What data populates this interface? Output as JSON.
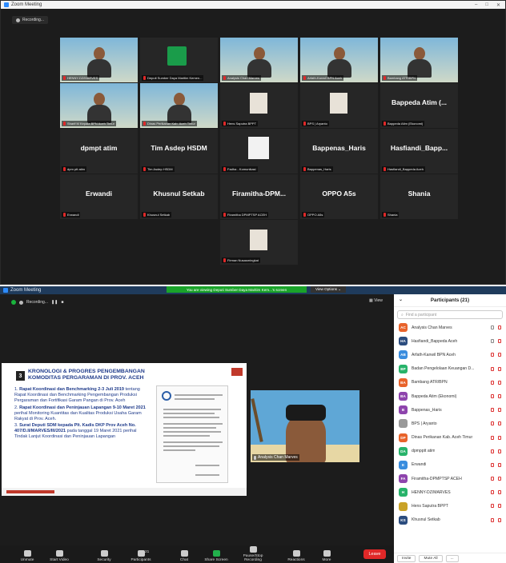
{
  "win1": {
    "title": "Zoom Meeting",
    "controls": [
      "–",
      "□",
      "✕"
    ],
    "recording": "Recording...",
    "tiles": [
      {
        "name": "",
        "label": "HENNY-DZ/MARVES",
        "kind": "video"
      },
      {
        "name": "",
        "label": "Deputi Sumber Daya Maritim Kemen...",
        "kind": "logo"
      },
      {
        "name": "",
        "label": "Analysis Chan Marves",
        "kind": "video",
        "selected": true
      },
      {
        "name": "",
        "label": "Arfath-Kanwil BPN Aceh",
        "kind": "video"
      },
      {
        "name": "",
        "label": "Bambang ATR/BPN",
        "kind": "video"
      },
      {
        "name": "",
        "label": "Sharif M Kepala BPN Aceh Timur",
        "kind": "video"
      },
      {
        "name": "",
        "label": "Dinas Perikanan Kab. Aceh Timur",
        "kind": "video"
      },
      {
        "name": "",
        "label": "Hens Saputra BPPT",
        "kind": "photo"
      },
      {
        "name": "",
        "label": "BPS | Aryanto",
        "kind": "photo"
      },
      {
        "name": "Bappeda Atim (...",
        "label": "Bappeda Atim (Ekonomi)",
        "kind": "name"
      },
      {
        "name": "dpmpt atim",
        "label": "dpm ptt atim",
        "kind": "name"
      },
      {
        "name": "Tim Asdep HSDM",
        "label": "Tim Asdep HSDM",
        "kind": "name"
      },
      {
        "name": "",
        "label": "Fadha - Komunikasi",
        "kind": "blank"
      },
      {
        "name": "Bappenas_Haris",
        "label": "Bappenas_Haris",
        "kind": "name"
      },
      {
        "name": "Hasfiandi_Bapp...",
        "label": "Hasfiandi_Bappeda Aceh",
        "kind": "name"
      },
      {
        "name": "Erwandi",
        "label": "Erwandi",
        "kind": "name"
      },
      {
        "name": "Khusnul Setkab",
        "label": "Khusnul Setkab",
        "kind": "name"
      },
      {
        "name": "Firamitha-DPM...",
        "label": "Firamitha DPMPTSP ACEH",
        "kind": "name"
      },
      {
        "name": "OPPO A5s",
        "label": "OPPO A5s",
        "kind": "name"
      },
      {
        "name": "Shania",
        "label": "Shania",
        "kind": "name"
      },
      {
        "name": "",
        "label": "Firman Nusasmingkat",
        "kind": "photo"
      }
    ]
  },
  "win2": {
    "title": "Zoom Meeting",
    "viewing": "You are viewing Deputi Sumber Daya Maritim Kem...'s screen",
    "view_options": "View Options ⌄",
    "recording": "Recording...",
    "view_label": "View",
    "slide": {
      "number": "3",
      "title_line1": "KRONOLOGI & PROGRES PENGEMBANGAN",
      "title_line2": "KOMODITAS PERGARAMAN DI PROV. ACEH",
      "items": [
        {
          "num": "1.",
          "bold": "Rapat Koordinasi dan Benchmarking 2-3 Juli 2019",
          "text": " tentang Rapat Koordinasi dan Benchmarking Pengembangan Produksi Pergaraman dan Fortifikasi Garam Pangan di Prov. Aceh"
        },
        {
          "num": "2.",
          "bold": "Rapat Koordinasi dan Peninjauan Lapangan 9-10 Maret 2021",
          "text": " perihal Monitoring Kuantitas dan Kualitas Produksi Usaha Garam Rakyat di Prov. Aceh."
        },
        {
          "num": "3.",
          "bold": "Surat Deputi SDM kepada Plt. Kadis DKP Prov Aceh No. 407/D.II/MARVES/III/2021",
          "text": " pada tanggal 19 Maret 2021 perihal Tindak Lanjut Koordinasi dan Peninjauan Lapangan"
        }
      ]
    },
    "speaker_label": "Analysis Chan Marves",
    "toolbar": [
      {
        "label": "Unmute",
        "icon": "microphone-icon"
      },
      {
        "label": "Start Video",
        "icon": "video-icon"
      },
      {
        "label": "Security",
        "icon": "shield-icon"
      },
      {
        "label": "Participants",
        "icon": "participants-icon",
        "count": "21"
      },
      {
        "label": "Chat",
        "icon": "chat-icon"
      },
      {
        "label": "Share Screen",
        "icon": "share-screen-icon"
      },
      {
        "label": "Pause/Stop Recording",
        "icon": "recording-icon"
      },
      {
        "label": "Reactions",
        "icon": "reactions-icon"
      },
      {
        "label": "More",
        "icon": "more-icon"
      }
    ],
    "leave": "Leave",
    "participants_panel": {
      "title": "Participants (21)",
      "search_placeholder": "Find a participant",
      "invite": "Invite",
      "mute_all": "Mute All",
      "more": "...",
      "list": [
        {
          "initials": "AC",
          "name": "Analysis Chan Marves",
          "color": "#e8632b",
          "muted": false
        },
        {
          "initials": "HA",
          "name": "Hasfiandi_Bappeda Aceh",
          "color": "#2b4c7e",
          "muted": false
        },
        {
          "initials": "AB",
          "name": "Arfath-Kanwil BPN Aceh",
          "color": "#3a8dde",
          "muted": true
        },
        {
          "initials": "BP",
          "name": "Badan Pengelolaan Keuangan D...",
          "color": "#27b36a",
          "muted": true
        },
        {
          "initials": "BA",
          "name": "Bambang ATR/BPN",
          "color": "#e8632b",
          "muted": true
        },
        {
          "initials": "BA",
          "name": "Bappeda Atim (Ekonomi)",
          "color": "#8e44ad",
          "muted": true
        },
        {
          "initials": "B",
          "name": "Bappenas_Haris",
          "color": "#8e44ad",
          "muted": true
        },
        {
          "initials": "",
          "name": "BPS | Aryanto",
          "color": "#999999",
          "muted": true
        },
        {
          "initials": "DP",
          "name": "Dinas Perikanan Kab. Aceh Timur",
          "color": "#e8632b",
          "muted": true
        },
        {
          "initials": "DA",
          "name": "dpmpptt atim",
          "color": "#27b36a",
          "muted": true
        },
        {
          "initials": "E",
          "name": "Erwandi",
          "color": "#3a8dde",
          "muted": true
        },
        {
          "initials": "FA",
          "name": "Firamitha-DPMPTSP ACEH",
          "color": "#8e44ad",
          "muted": true
        },
        {
          "initials": "H",
          "name": "HENNY-DZ/MARVES",
          "color": "#27b36a",
          "muted": true
        },
        {
          "initials": "",
          "name": "Hens Saputra BPPT",
          "color": "#c9a227",
          "muted": true
        },
        {
          "initials": "KS",
          "name": "Khusnul Setkab",
          "color": "#2b4c7e",
          "muted": true
        }
      ]
    }
  }
}
